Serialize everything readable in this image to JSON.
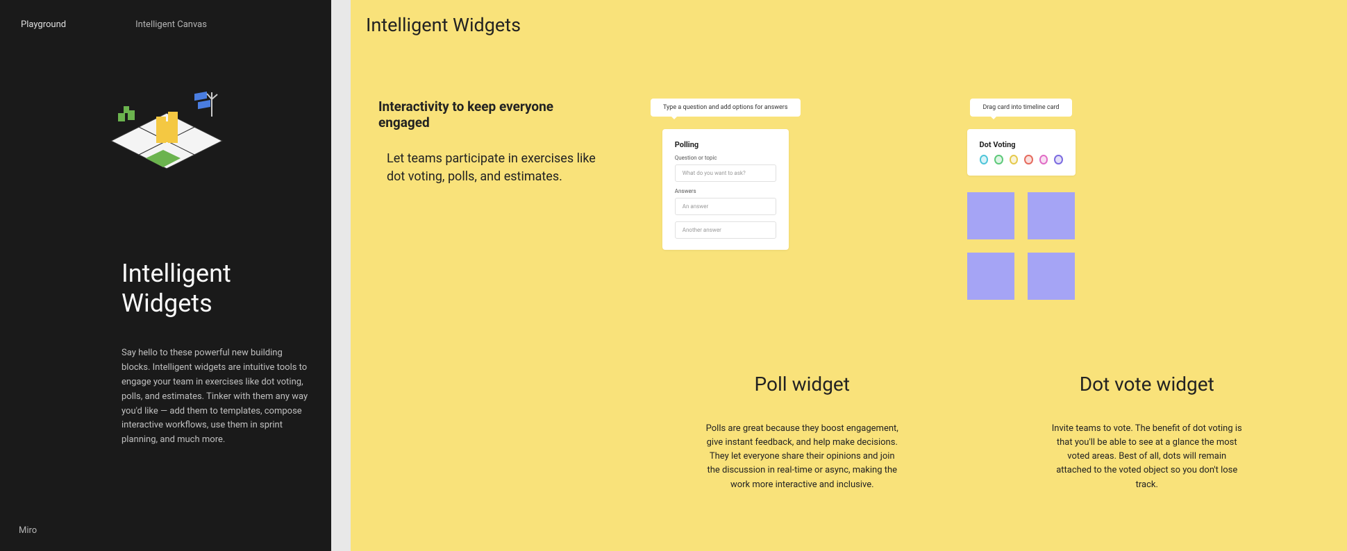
{
  "sidebar": {
    "nav1": "Playground",
    "nav2": "Intelligent Canvas",
    "title": "Intelligent Widgets",
    "description": "Say hello to these powerful new building blocks. Intelligent widgets are intuitive tools to engage your team in exercises like dot voting, polls, and estimates. Tinker with them any way you'd like — add them to templates, compose interactive workflows, use them in sprint planning, and much more.",
    "footer": "Miro"
  },
  "main": {
    "title": "Intelligent Widgets",
    "intro_heading": "Interactivity to keep everyone engaged",
    "intro_text": "Let teams participate in exercises like dot voting, polls, and estimates."
  },
  "poll": {
    "bubble": "Type a question and add options for answers",
    "card_title": "Polling",
    "label1": "Question or topic",
    "input1": "What do you want to ask?",
    "label2": "Answers",
    "input2": "An answer",
    "input3": "Another answer",
    "section_title": "Poll widget",
    "section_desc": "Polls are great because they boost engagement, give instant feedback, and help make decisions. They let everyone share their opinions and join the discussion in real-time or async, making the work more interactive and inclusive."
  },
  "dotvote": {
    "bubble": "Drag card into timeline card",
    "card_title": "Dot Voting",
    "section_title": "Dot vote widget",
    "section_desc": "Invite teams to vote. The benefit of dot voting is that you'll be able to see at a glance the most voted areas. Best of all, dots will remain attached to the voted object so you don't lose track."
  }
}
